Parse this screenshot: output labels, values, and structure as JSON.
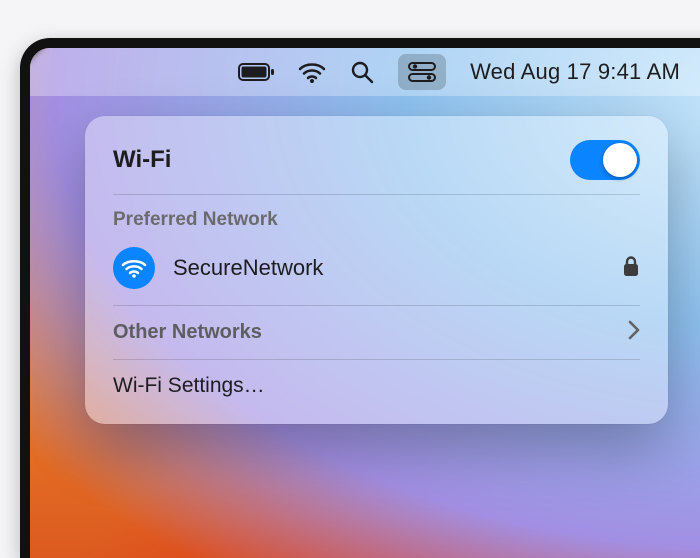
{
  "menubar": {
    "date_time": "Wed Aug 17  9:41 AM"
  },
  "panel": {
    "title": "Wi-Fi",
    "wifi_on": true,
    "preferred_label": "Preferred Network",
    "network": {
      "name": "SecureNetwork",
      "secure": true
    },
    "other_label": "Other Networks",
    "settings_label": "Wi-Fi Settings…"
  }
}
